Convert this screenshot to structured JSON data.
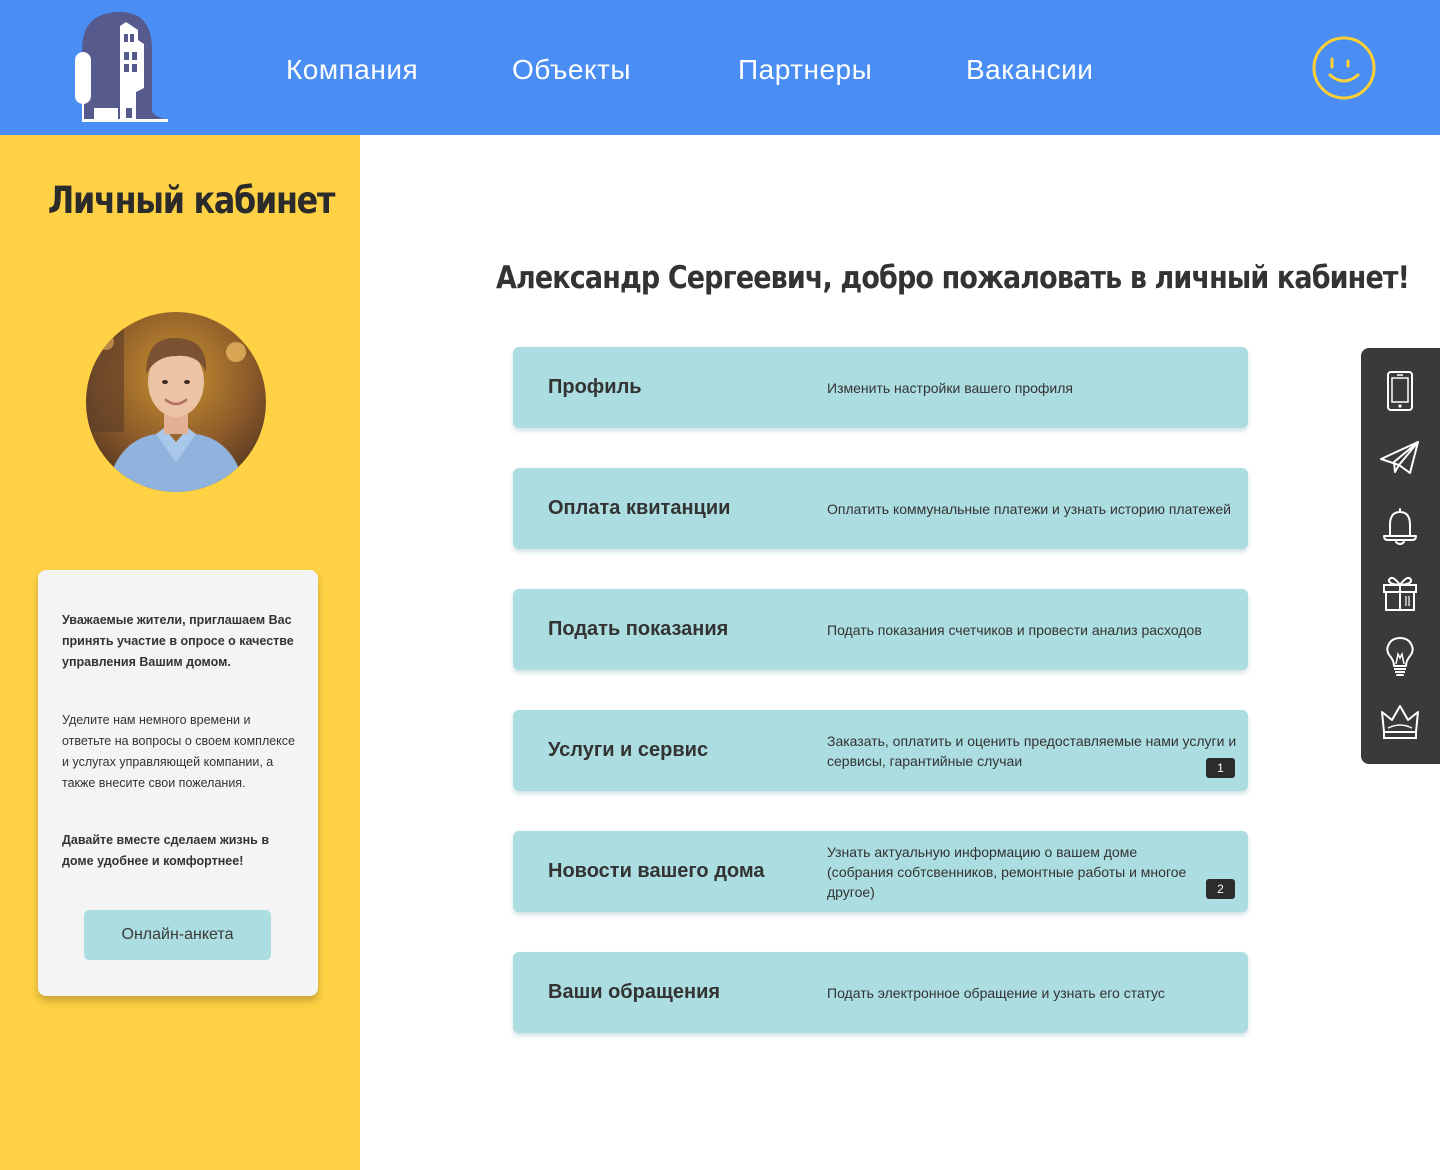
{
  "header": {
    "nav": [
      "Компания",
      "Объекты",
      "Партнеры",
      "Вакансии"
    ],
    "brand_color": "#4a8ef3",
    "logo_icon": "building-icon",
    "account_icon": "smiley-icon"
  },
  "sidebar": {
    "title": "Личный кабинет",
    "background": "#ffd144",
    "survey": {
      "intro": "Уважаемые жители, приглашаем Вас принять участие в опросе о качестве управления Вашим домом.",
      "body": "Уделите нам немного времени и ответьте на вопросы о своем комплексе и услугах управляющей компании, а также внесите свои пожелания.",
      "closing": "Давайте вместе сделаем жизнь в доме удобнее и комфортнее!",
      "button": "Онлайн-анкета"
    }
  },
  "main": {
    "welcome": "Александр Сергеевич, добро пожаловать в личный кабинет!",
    "card_color": "#acdde0",
    "cards": [
      {
        "title": "Профиль",
        "desc": "Изменить настройки вашего профиля"
      },
      {
        "title": "Оплата квитанции",
        "desc": "Оплатить коммунальные платежи и узнать историю платежей"
      },
      {
        "title": "Подать показания",
        "desc": "Подать показания счетчиков и провести анализ расходов"
      },
      {
        "title": "Услуги и сервис",
        "desc": "Заказать, оплатить и оценить предоставляемые нами услуги и сервисы, гарантийные случаи",
        "badge": "1"
      },
      {
        "title": "Новости вашего дома",
        "desc": "Узнать актуальную информацию о вашем доме (собрания собтсвенников, ремонтные работы и многое другое)",
        "badge": "2"
      },
      {
        "title": "Ваши обращения",
        "desc": "Подать электронное обращение и узнать его статус"
      }
    ]
  },
  "toolbar": {
    "icons": [
      "tablet-icon",
      "paper-plane-icon",
      "bell-icon",
      "gift-icon",
      "lightbulb-icon",
      "crown-icon"
    ]
  }
}
